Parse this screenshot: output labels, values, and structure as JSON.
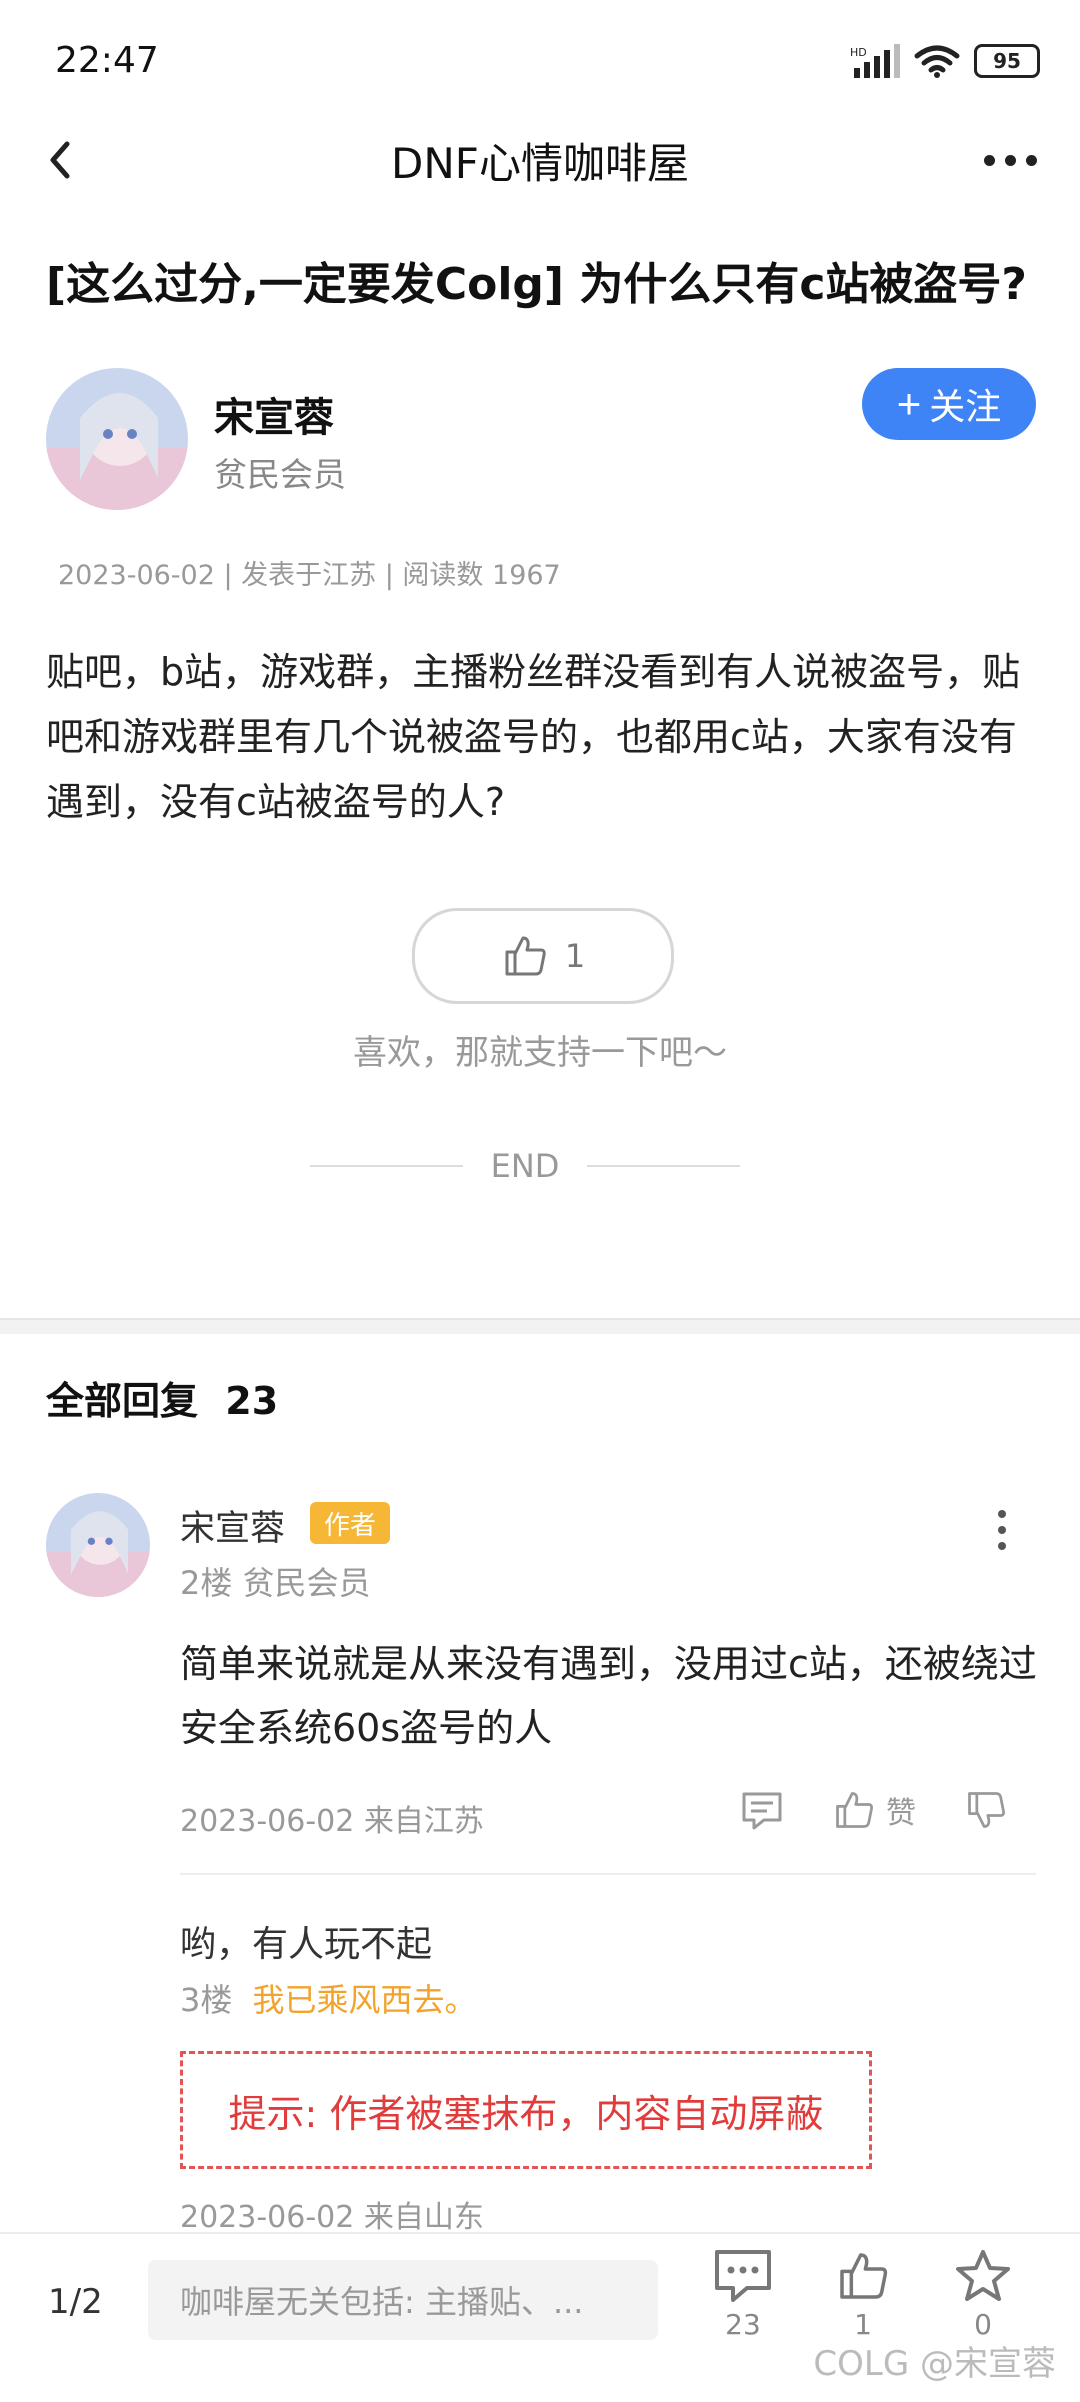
{
  "status_bar": {
    "time": "22:47",
    "battery": "95"
  },
  "header": {
    "title": "DNF心情咖啡屋"
  },
  "post": {
    "title": "[这么过分,一定要发Colg] 为什么只有c站被盗号?",
    "author": {
      "name": "宋宣蓉",
      "level": "贫民会员",
      "follow_label": "关注"
    },
    "meta": "2023-06-02 | 发表于江苏 | 阅读数 1967",
    "body": "贴吧，b站，游戏群，主播粉丝群没看到有人说被盗号，贴吧和游戏群里有几个说被盗号的，也都用c站，大家有没有遇到，没有c站被盗号的人?",
    "like_count": "1",
    "like_hint": "喜欢，那就支持一下吧～",
    "end_label": "END"
  },
  "replies": {
    "header_label": "全部回复",
    "count": "23",
    "items": [
      {
        "name": "宋宣蓉",
        "badge": "作者",
        "floor_level": "2楼 贫民会员",
        "content": "简单来说就是从来没有遇到，没用过c站，还被绕过安全系统60s盗号的人",
        "meta": "2023-06-02 来自江苏",
        "like_label": "赞",
        "sub_reply": {
          "content": "哟，有人玩不起",
          "floor": "3楼",
          "author": "我已乘风西去。",
          "notice": "提示: 作者被塞抹布，内容自动屏蔽",
          "meta": "2023-06-02 来自山东"
        }
      }
    ]
  },
  "bottom_bar": {
    "page": "1/2",
    "input_placeholder": "咖啡屋无关包括: 主播贴、...",
    "comment_count": "23",
    "like_count": "1",
    "fav_count": "0",
    "watermark": "COLG @宋宣蓉"
  },
  "colors": {
    "accent": "#3f84f6",
    "badge": "#f6b636",
    "warning": "#e23b3b",
    "author_link": "#f2a32b"
  }
}
